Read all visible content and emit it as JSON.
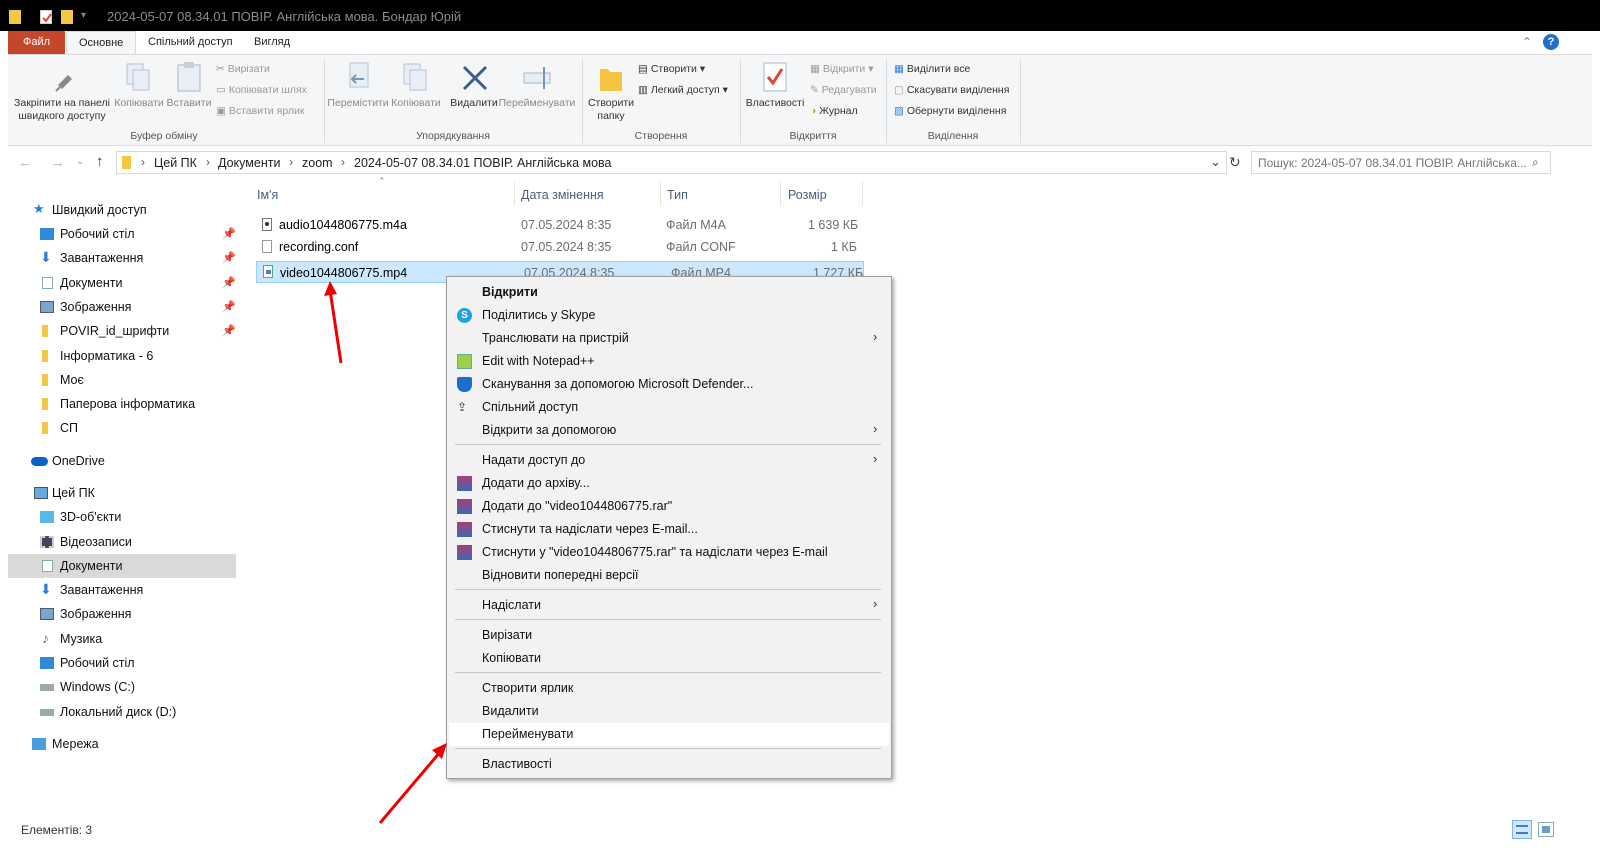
{
  "window": {
    "title": "2024-05-07 08.34.01 ПОВІР. Англійська мова. Бондар Юрій",
    "help_icon": "help-icon"
  },
  "ribbon_tabs": [
    "Файл",
    "Основне",
    "Спільний доступ",
    "Вигляд"
  ],
  "ribbon": {
    "clipboard": {
      "pin": "Закріпити на панелі швидкого доступу",
      "copy": "Копіювати",
      "paste": "Вставити",
      "cut": "Вирізати",
      "copy_path": "Копіювати шлях",
      "paste_shortcut": "Вставити ярлик",
      "group": "Буфер обміну"
    },
    "organize": {
      "move": "Перемістити",
      "copy_to": "Копіювати",
      "delete": "Видалити",
      "rename": "Перейменувати",
      "group": "Упорядкування"
    },
    "create": {
      "new_folder": "Створити папку",
      "new_item": "Створити",
      "easy_access": "Легкий доступ",
      "group": "Створення"
    },
    "open": {
      "properties": "Властивості",
      "open": "Відкрити",
      "edit": "Редагувати",
      "history": "Журнал",
      "group": "Відкриття"
    },
    "select": {
      "select_all": "Виділити все",
      "select_none": "Скасувати виділення",
      "invert": "Обернути виділення",
      "group": "Виділення"
    }
  },
  "address": {
    "crumbs": [
      "Цей ПК",
      "Документи",
      "zoom",
      "2024-05-07 08.34.01 ПОВІР. Англійська мова"
    ],
    "search_placeholder": "Пошук: 2024-05-07 08.34.01 ПОВІР. Англійська..."
  },
  "sidebar": {
    "quick_access": "Швидкий доступ",
    "quick_items": [
      "Робочий стіл",
      "Завантаження",
      "Документи",
      "Зображення",
      "POVIR_id_шрифти",
      "Інформатика - 6",
      "Моє",
      "Паперова інформатика",
      "СП"
    ],
    "onedrive": "OneDrive",
    "this_pc": "Цей ПК",
    "pc_items": [
      "3D-об'єкти",
      "Відеозаписи",
      "Документи",
      "Завантаження",
      "Зображення",
      "Музика",
      "Робочий стіл",
      "Windows (C:)",
      "Локальний диск (D:)"
    ],
    "network": "Мережа"
  },
  "columns": {
    "name": "Ім'я",
    "date": "Дата змінення",
    "type": "Тип",
    "size": "Розмір"
  },
  "files": [
    {
      "name": "audio1044806775.m4a",
      "date": "07.05.2024 8:35",
      "type": "Файл M4A",
      "size": "1 639 КБ"
    },
    {
      "name": "recording.conf",
      "date": "07.05.2024 8:35",
      "type": "Файл CONF",
      "size": "1 КБ"
    },
    {
      "name": "video1044806775.mp4",
      "date": "07.05.2024 8:35",
      "type": "Файл MP4",
      "size": "1 727 КБ"
    }
  ],
  "context_menu": [
    "Відкрити",
    "Поділитись у Skype",
    "Транслювати на пристрій",
    "Edit with Notepad++",
    "Сканування за допомогою Microsoft Defender...",
    "Спільний доступ",
    "Відкрити за допомогою",
    "Надати доступ до",
    "Додати до архіву...",
    "Додати до \"video1044806775.rar\"",
    "Стиснути та надіслати через E-mail...",
    "Стиснути у \"video1044806775.rar\" та надіслати через E-mail",
    "Відновити попередні версії",
    "Надіслати",
    "Вирізати",
    "Копіювати",
    "Створити ярлик",
    "Видалити",
    "Перейменувати",
    "Властивості"
  ],
  "status": {
    "count": "Елементів: 3"
  },
  "colors": {
    "file_tab": "#c4472c",
    "selection": "#cce8ff",
    "annotation_arrow": "#ee0000"
  }
}
